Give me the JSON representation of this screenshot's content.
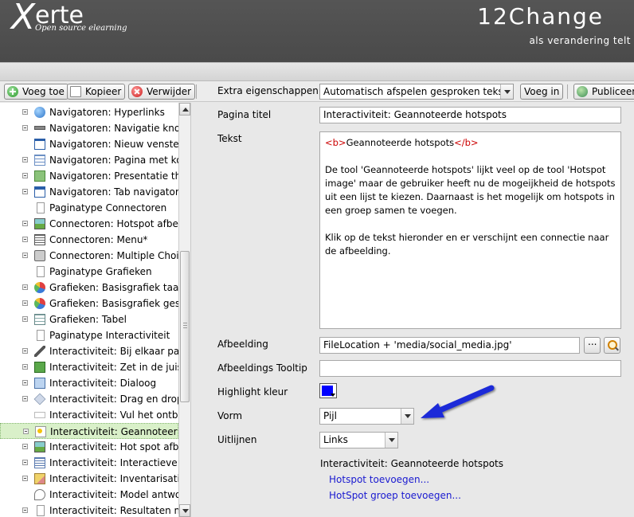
{
  "header": {
    "logo_x": "X",
    "logo_rest": "erte",
    "logo_tagline": "Open source elearning",
    "brand": "12Change",
    "brand_tagline": "als verandering telt"
  },
  "toolbar": {
    "add_label": "Voeg toe",
    "copy_label": "Kopieer",
    "delete_label": "Verwijder",
    "extra_label": "Extra eigenschappen:",
    "extra_select_value": "Automatisch afspelen gesproken tekst",
    "insert_label": "Voeg in",
    "publish_label": "Publiceer"
  },
  "tree": {
    "items": [
      {
        "label": "Navigatoren: Hyperlinks",
        "icon": "globe-icon"
      },
      {
        "label": "Navigatoren: Navigatie knop",
        "icon": "bar-icon"
      },
      {
        "label": "Navigatoren: Nieuw venster",
        "icon": "window-icon"
      },
      {
        "label": "Navigatoren: Pagina met kolo",
        "icon": "grid-icon"
      },
      {
        "label": "Navigatoren: Presentatie thur",
        "icon": "presentation-icon"
      },
      {
        "label": "Navigatoren: Tab navigator",
        "icon": "tab-icon"
      },
      {
        "label": "Paginatype Connectoren",
        "icon": "page-icon"
      },
      {
        "label": "Connectoren: Hotspot afbeeld",
        "icon": "image-icon"
      },
      {
        "label": "Connectoren: Menu*",
        "icon": "menu-icon"
      },
      {
        "label": "Connectoren: Multiple Choice",
        "icon": "multiple-choice-icon"
      },
      {
        "label": "Paginatype Grafieken",
        "icon": "page-icon"
      },
      {
        "label": "Grafieken: Basisgrafiek taart",
        "icon": "pie-chart-icon"
      },
      {
        "label": "Grafieken: Basisgrafiek gesta",
        "icon": "pie-chart-icon"
      },
      {
        "label": "Grafieken: Tabel",
        "icon": "table-icon"
      },
      {
        "label": "Paginatype Interactiviteit",
        "icon": "page-icon"
      },
      {
        "label": "Interactiviteit: Bij elkaar passe",
        "icon": "connect-icon"
      },
      {
        "label": "Interactiviteit: Zet in de juiste o",
        "icon": "green-block-icon"
      },
      {
        "label": "Interactiviteit: Dialoog",
        "icon": "dialog-icon"
      },
      {
        "label": "Interactiviteit: Drag en drop la",
        "icon": "tag-icon"
      },
      {
        "label": "Interactiviteit: Vul het ontbreke",
        "icon": "blank-field-icon"
      },
      {
        "label": "Interactiviteit: Geannoteerde h",
        "icon": "hotspot-icon"
      },
      {
        "label": "Interactiviteit: Hot spot afbeelc",
        "icon": "image-icon"
      },
      {
        "label": "Interactiviteit: Interactieve lijst",
        "icon": "list-icon"
      },
      {
        "label": "Interactiviteit: Inventarisatie",
        "icon": "pencil-icon"
      },
      {
        "label": "Interactiviteit: Model antwoord",
        "icon": "speech-bubble-icon"
      },
      {
        "label": "Interactiviteit: Resultaten moc",
        "icon": "page-icon"
      }
    ],
    "selected_index": 20
  },
  "form": {
    "title_label": "Pagina titel",
    "title_value": "Interactiviteit: Geannoteerde hotspots",
    "text_label": "Tekst",
    "text_tag_open": "<b>",
    "text_heading": "Geannoteerde hotspots",
    "text_tag_close": "</b>",
    "text_para1": "De tool 'Geannoteerde hotspots' lijkt veel op de tool 'Hotspot image' maar de gebruiker heeft nu de mogeijkheid de hotspots uit een lijst te kiezen. Daarnaast is het mogelijk om hotspots in een groep samen te voegen.",
    "text_para2": "Klik op de tekst hieronder en er verschijnt een connectie naar de afbeelding.",
    "image_label": "Afbeelding",
    "image_value": "FileLocation + 'media/social_media.jpg'",
    "image_tooltip_label": "Afbeeldings Tooltip",
    "image_tooltip_value": "",
    "highlight_label": "Highlight kleur",
    "highlight_color": "#0000ff",
    "shape_label": "Vorm",
    "shape_value": "Pijl",
    "align_label": "Uitlijnen",
    "align_value": "Links",
    "subtitle": "Interactiviteit: Geannoteerde hotspots",
    "add_hotspot_link": "Hotspot toevoegen...",
    "add_group_link": "HotSpot groep toevoegen..."
  },
  "colors": {
    "header_bg": "#4d4d4d",
    "selection_bg": "#d9f0c9",
    "link": "#1a1ad0",
    "annotation_arrow": "#1a2ad8"
  }
}
